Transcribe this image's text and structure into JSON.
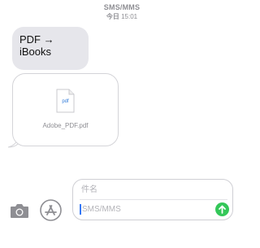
{
  "header": {
    "service": "SMS/MMS",
    "day": "今日",
    "time": "15:01"
  },
  "messages": [
    {
      "type": "text",
      "text": "PDF → iBooks"
    },
    {
      "type": "attachment",
      "file_type_label": "pdf",
      "file_name": "Adobe_PDF.pdf",
      "icon": "pdf-document-icon"
    }
  ],
  "composer": {
    "subject_placeholder": "件名",
    "message_placeholder": "SMS/MMS",
    "camera_icon": "camera-icon",
    "appstore_icon": "app-store-icon",
    "send_icon": "arrow-up-icon",
    "send_color": "#34c759",
    "cursor_color": "#3478f6"
  },
  "colors": {
    "bubble_gray": "#e6e6eb",
    "meta_gray": "#8e8e93",
    "icon_gray": "#8e8e93"
  }
}
